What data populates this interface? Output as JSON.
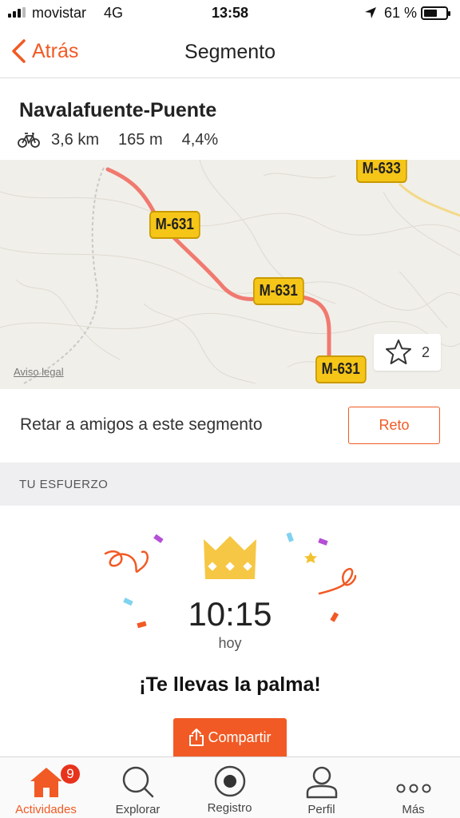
{
  "status_bar": {
    "carrier": "movistar",
    "network": "4G",
    "time": "13:58",
    "battery": "61 %",
    "battery_level": 0.61
  },
  "nav": {
    "back_label": "Atrás",
    "title": "Segmento"
  },
  "segment": {
    "name": "Navalafuente-Puente",
    "activity_icon": "bike-icon",
    "distance": "3,6 km",
    "elevation": "165 m",
    "grade": "4,4%"
  },
  "map": {
    "road_labels": [
      "M-633",
      "M-631",
      "M-631",
      "M-631"
    ],
    "legal_link": "Aviso legal",
    "star_count": "2",
    "route_color": "#f07a70"
  },
  "challenge": {
    "text": "Retar a amigos a este segmento",
    "button": "Reto"
  },
  "effort": {
    "section_title": "TU ESFUERZO",
    "time": "10:15",
    "when": "hoy",
    "message": "¡Te llevas la palma!",
    "share_button": "Compartir",
    "crown_color": "#f6c744"
  },
  "tabbar": {
    "items": [
      {
        "label": "Actividades",
        "icon": "home-icon",
        "badge": "9",
        "active": true
      },
      {
        "label": "Explorar",
        "icon": "search-icon"
      },
      {
        "label": "Registro",
        "icon": "record-icon"
      },
      {
        "label": "Perfil",
        "icon": "person-icon"
      },
      {
        "label": "Más",
        "icon": "more-icon"
      }
    ]
  },
  "colors": {
    "accent": "#f15a24",
    "badge": "#e8331c"
  }
}
